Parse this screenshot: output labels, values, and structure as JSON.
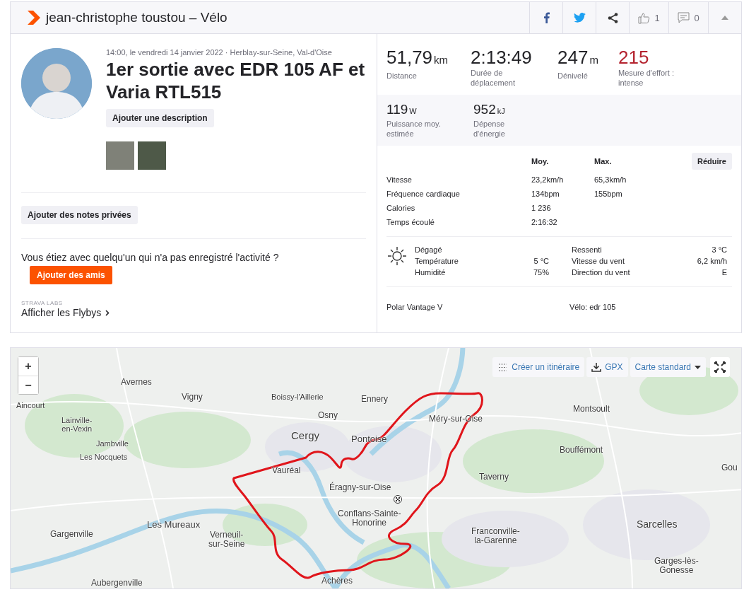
{
  "header": {
    "title": "jean-christophe toustou – Vélo",
    "like_count": "1",
    "comment_count": "0"
  },
  "activity": {
    "datetime_location": "14:00, le vendredi 14 janvier 2022 · Herblay-sur-Seine, Val-d'Oise",
    "title": "1er sortie avec EDR 105 AF et Varia RTL515",
    "add_description": "Ajouter une description",
    "private_notes": "Ajouter des notes privées",
    "friends_prompt": "Vous étiez avec quelqu'un qui n'a pas enregistré l'activité ?",
    "add_friends": "Ajouter des amis",
    "labs_label": "STRAVA LABS",
    "flybys_link": "Afficher les Flybys"
  },
  "primary_stats": [
    {
      "value": "51,79",
      "unit": "km",
      "label": "Distance",
      "accent": false
    },
    {
      "value": "2:13:49",
      "label": "Durée de déplacement",
      "accent": false
    },
    {
      "value": "247",
      "unit": "m",
      "label": "Dénivelé",
      "accent": false
    },
    {
      "value": "215",
      "label": "Mesure d'effort : intense",
      "accent": true
    }
  ],
  "secondary_stats": [
    {
      "value": "119",
      "unit": "W",
      "label": "Puissance moy. estimée"
    },
    {
      "value": "952",
      "unit": "kJ",
      "label": "Dépense d'énergie"
    }
  ],
  "details": {
    "columns": [
      "Moy.",
      "Max."
    ],
    "collapse_button": "Réduire",
    "rows": [
      {
        "label": "Vitesse",
        "avg": "23,2km/h",
        "max": "65,3km/h"
      },
      {
        "label": "Fréquence cardiaque",
        "avg": "134bpm",
        "max": "155bpm"
      },
      {
        "label": "Calories",
        "avg": "1 236"
      },
      {
        "label": "Temps écoulé",
        "avg": "2:16:32"
      }
    ]
  },
  "weather": {
    "condition": "Dégagé",
    "left": [
      {
        "label": "Température",
        "value": "5 °C"
      },
      {
        "label": "Humidité",
        "value": "75%"
      }
    ],
    "right": [
      {
        "label": "Ressenti",
        "value": "3 °C"
      },
      {
        "label": "Vitesse du vent",
        "value": "6,2 km/h"
      },
      {
        "label": "Direction du vent",
        "value": "E"
      }
    ]
  },
  "gear": {
    "device": "Polar Vantage V",
    "bike": "Vélo: edr 105"
  },
  "map": {
    "zoom_in": "+",
    "zoom_out": "−",
    "create_route": "Créer un itinéraire",
    "gpx": "GPX",
    "map_type": "Carte standard",
    "labels": [
      "Avernes",
      "Vigny",
      "Boissy-l'Aillerie",
      "Ennery",
      "Osny",
      "Aincourt",
      "Lainville-\nen-Vexin",
      "Cergy",
      "Pontoise",
      "Méry-sur-Oise",
      "Montsoult",
      "Jambville",
      "Les Nocquets",
      "Bouffémont",
      "Vauréal",
      "Éragny-sur-Oise",
      "Taverny",
      "Gou",
      "Gargenville",
      "Les Mureaux",
      "Verneuil-\nsur-Seine",
      "Conflans-Sainte-\nHonorine",
      "Franconville-\nla-Garenne",
      "Sarcelles",
      "Garges-lès-\nGonesse",
      "Achères",
      "Aubergenville"
    ]
  }
}
